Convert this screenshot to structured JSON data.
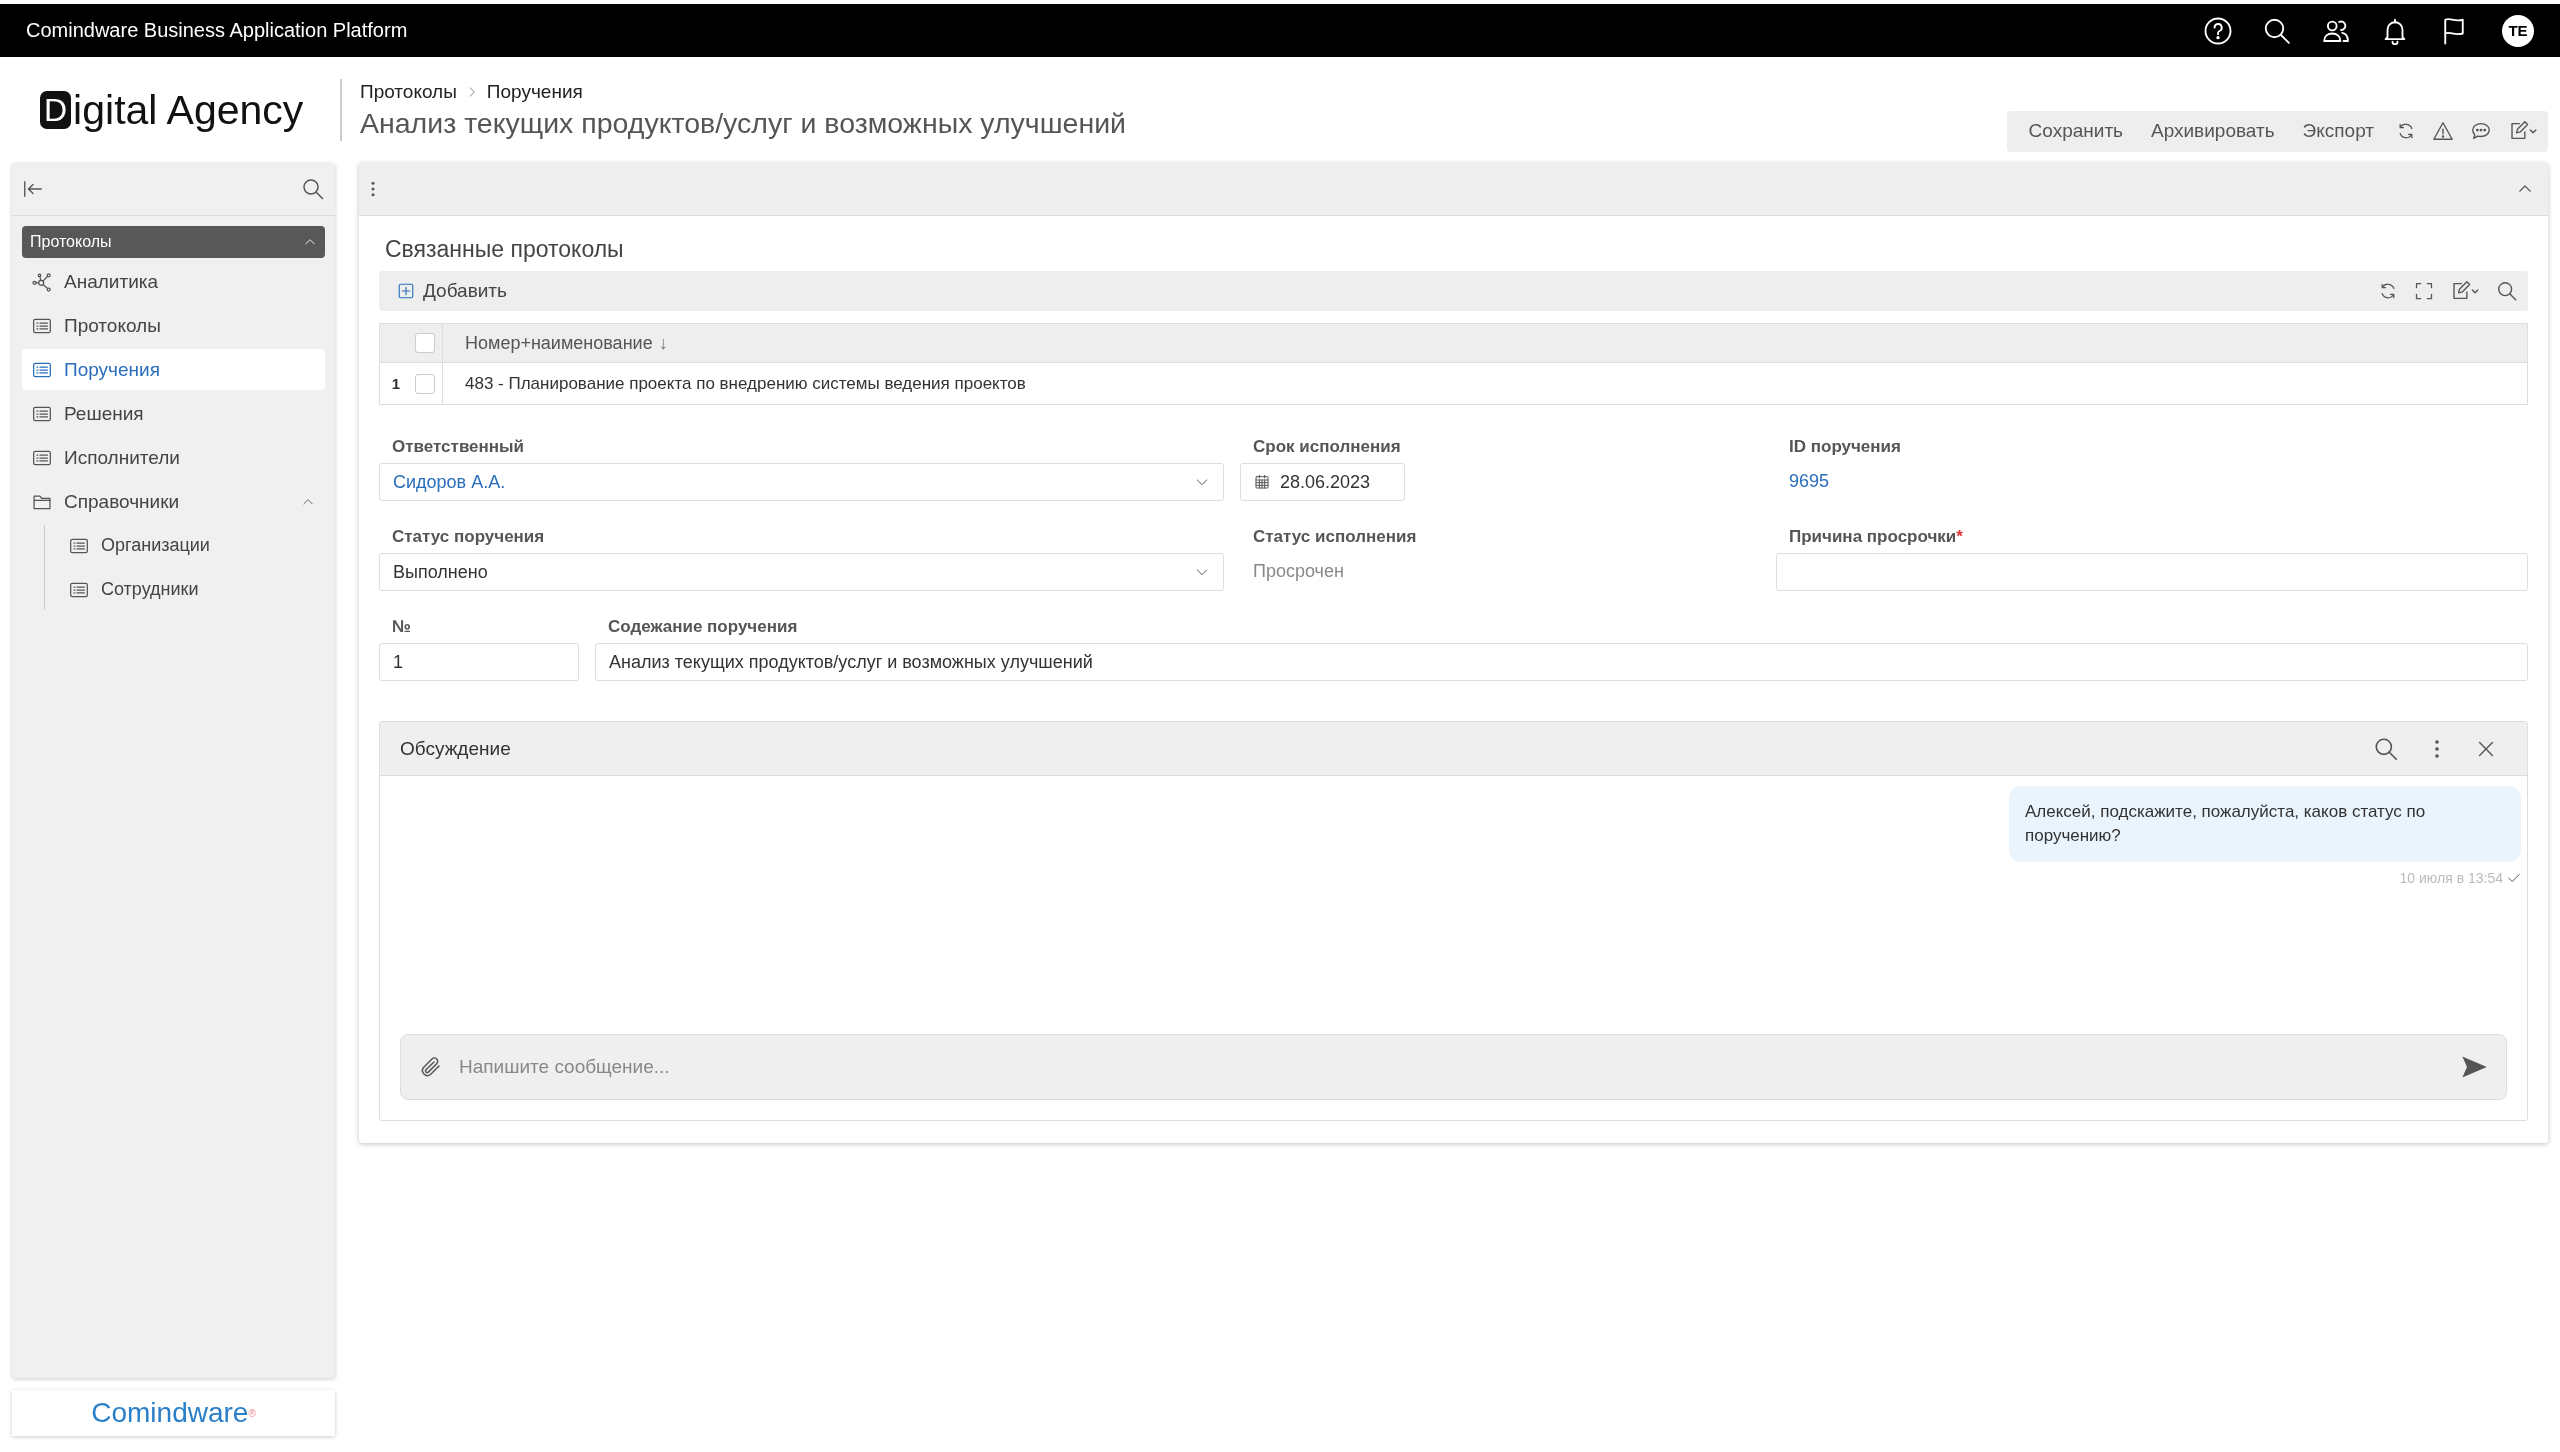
{
  "app_bar": {
    "title": "Comindware Business Application Platform",
    "avatar": "TE"
  },
  "header": {
    "logo_mark": "D",
    "logo_text": "igital Agency",
    "breadcrumbs": [
      {
        "label": "Протоколы"
      },
      {
        "label": "Поручения"
      }
    ],
    "title": "Анализ текущих продуктов/услуг и возможных улучшений",
    "actions": [
      "Сохранить",
      "Архивировать",
      "Экспорт"
    ]
  },
  "sidebar": {
    "section": {
      "label": "Протоколы",
      "expanded": true
    },
    "items": [
      {
        "label": "Аналитика",
        "kind": "analytics",
        "selected": false
      },
      {
        "label": "Протоколы",
        "kind": "list",
        "selected": false
      },
      {
        "label": "Поручения",
        "kind": "list",
        "selected": true
      },
      {
        "label": "Решения",
        "kind": "list",
        "selected": false
      },
      {
        "label": "Исполнители",
        "kind": "list",
        "selected": false
      },
      {
        "label": "Справочники",
        "kind": "folder",
        "selected": false,
        "expanded": true,
        "children": [
          {
            "label": "Организации",
            "kind": "list",
            "selected": false
          },
          {
            "label": "Сотрудники",
            "kind": "list",
            "selected": false
          }
        ]
      }
    ],
    "footer_logo": "Comindware$^{®}$"
  },
  "panel": {
    "expanded": true,
    "linked_protocols": {
      "title": "Связанные протоколы",
      "add_label": "Добавить",
      "all_checked": false,
      "columns": [
        {
          "label": "Номер+наименование",
          "sort_mark": "↓"
        }
      ],
      "rows": [
        {
          "number": "1",
          "checked": false,
          "cells": [
            "483 - Планирование проекта по внедрению системы ведения проектов"
          ]
        }
      ]
    },
    "field_rows": [
      [
        {
          "label": "Ответственный",
          "kind": "reference",
          "value": "Сидоров А.А."
        },
        {
          "label": "Срок исполнения",
          "kind": "date",
          "value": "28.06.2023"
        },
        {
          "label": "ID поручения",
          "kind": "link",
          "value": "9695"
        }
      ],
      [
        {
          "label": "Статус поручения",
          "kind": "dropdown",
          "value": "Выполнено"
        },
        {
          "label": "Статус исполнения",
          "kind": "readonly",
          "value": "Просрочен"
        },
        {
          "label": "Причина просрочки",
          "kind": "text",
          "required_mark": "*"
        }
      ],
      [
        {
          "label": "№",
          "kind": "text",
          "value": "1"
        },
        {
          "label": "Содежание поручения",
          "kind": "text",
          "value": "Анализ текущих продуктов/услуг и возможных улучшений"
        }
      ]
    ],
    "discussion": {
      "title": "Обсуждение",
      "placeholder": "Напишите сообщение...",
      "messages": [
        {
          "text": "Алексей, подскажите, пожалуйста, каков статус по поручению?",
          "time": "10 июля в 13:54",
          "read": true
        }
      ]
    }
  }
}
